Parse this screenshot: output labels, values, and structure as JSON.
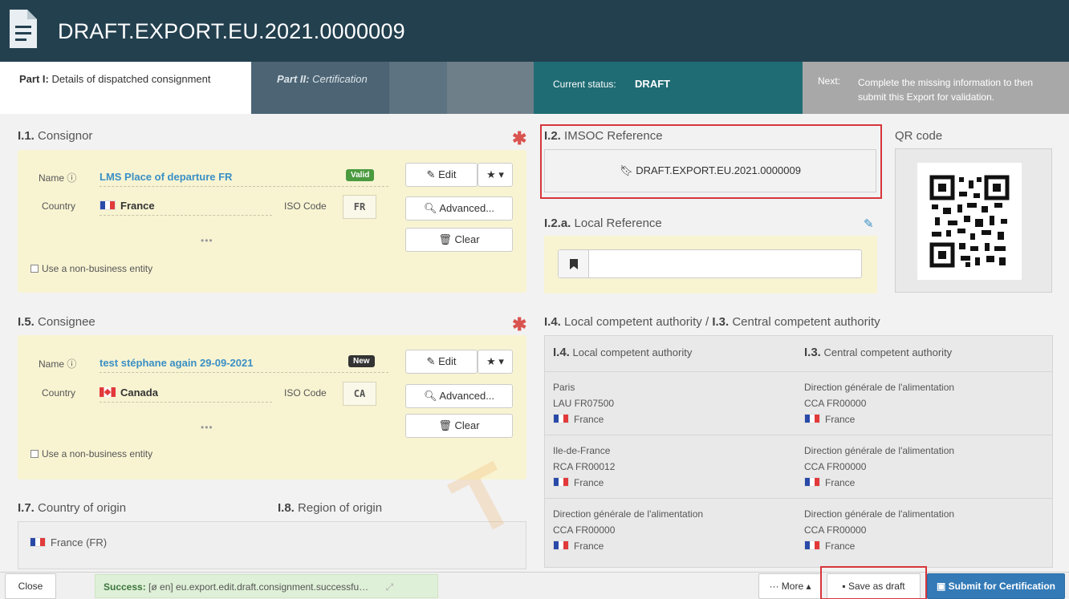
{
  "header": {
    "title": "DRAFT.EXPORT.EU.2021.0000009"
  },
  "tabs": {
    "part1_prefix": "Part I:",
    "part1_label": "Details of dispatched consignment",
    "part2_prefix": "Part II:",
    "part2_label": "Certification"
  },
  "status": {
    "label": "Current status:",
    "value": "DRAFT",
    "next_label": "Next:",
    "next_text": "Complete the missing information to then submit this Export for validation."
  },
  "consignor": {
    "code": "I.1.",
    "title": "Consignor",
    "name_label": "Name",
    "name_value": "LMS Place of departure FR",
    "badge": "Valid",
    "country_label": "Country",
    "country_value": "France",
    "iso_label": "ISO Code",
    "iso_value": "FR",
    "dots": "•••",
    "non_business": "Use a non-business entity",
    "edit": "Edit",
    "advanced": "Advanced...",
    "clear": "Clear"
  },
  "consignee": {
    "code": "I.5.",
    "title": "Consignee",
    "name_label": "Name",
    "name_value": "test stéphane again 29-09-2021",
    "badge": "New",
    "country_label": "Country",
    "country_value": "Canada",
    "iso_label": "ISO Code",
    "iso_value": "CA",
    "dots": "•••",
    "non_business": "Use a non-business entity",
    "edit": "Edit",
    "advanced": "Advanced...",
    "clear": "Clear"
  },
  "imsoc": {
    "code": "I.2.",
    "title": "IMSOC Reference",
    "value": "DRAFT.EXPORT.EU.2021.0000009"
  },
  "qr": {
    "title": "QR code"
  },
  "local_ref": {
    "code": "I.2.a.",
    "title": "Local Reference",
    "value": ""
  },
  "authority": {
    "heading_code1": "I.4.",
    "heading_text1": "Local competent authority /",
    "heading_code2": "I.3.",
    "heading_text2": "Central competent authority",
    "col1_code": "I.4.",
    "col1_title": "Local competent authority",
    "col2_code": "I.3.",
    "col2_title": "Central competent authority",
    "rows": [
      {
        "l_name": "Paris",
        "l_code": "LAU FR07500",
        "l_country": "France",
        "c_name": "Direction générale de l'alimentation",
        "c_code": "CCA FR00000",
        "c_country": "France"
      },
      {
        "l_name": "Ile-de-France",
        "l_code": "RCA FR00012",
        "l_country": "France",
        "c_name": "Direction générale de l'alimentation",
        "c_code": "CCA FR00000",
        "c_country": "France"
      },
      {
        "l_name": "Direction générale de l'alimentation",
        "l_code": "CCA FR00000",
        "l_country": "France",
        "c_name": "Direction générale de l'alimentation",
        "c_code": "CCA FR00000",
        "c_country": "France"
      }
    ]
  },
  "origin": {
    "country_code": "I.7.",
    "country_title": "Country of origin",
    "region_code": "I.8.",
    "region_title": "Region of origin",
    "country_value": "France (FR)"
  },
  "footer": {
    "close": "Close",
    "success_label": "Success:",
    "success_text": "[ø en] eu.export.edit.draft.consignment.successfu…",
    "more": "··· More ▴",
    "save_draft": "Save as draft",
    "submit": "Submit for Certification"
  },
  "colors": {
    "header": "#23404f",
    "status": "#1f6c74",
    "accent": "#337ab7",
    "required": "#d9534f"
  }
}
